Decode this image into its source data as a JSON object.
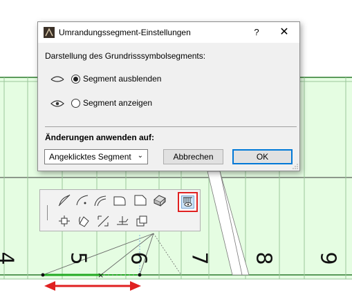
{
  "dialog": {
    "title": "Umrandungssegment-Einstellungen",
    "help_glyph": "?",
    "close_glyph": "✕",
    "group_label": "Darstellung des Grundrisssymbolsegments:",
    "options": [
      {
        "label": "Segment ausblenden",
        "selected": true,
        "icon": "eye-closed-icon"
      },
      {
        "label": "Segment anzeigen",
        "selected": false,
        "icon": "eye-open-icon"
      }
    ],
    "apply_label": "Änderungen anwenden auf:",
    "apply_select_value": "Angeklicktes Segment",
    "cancel_label": "Abbrechen",
    "ok_label": "OK"
  },
  "drawing": {
    "grid_labels": [
      "4",
      "5",
      "6",
      "7",
      "8",
      "9"
    ],
    "background_color": "#e5fde2",
    "line_color": "#2a7a2a",
    "highlight_color": "#e02020"
  },
  "palette": {
    "tools": [
      "arc-tangent-icon",
      "arc-center-icon",
      "arc-three-point-icon",
      "corner-round-icon",
      "corner-chamfer-icon",
      "extrude-3d-icon",
      "segment-visibility-icon",
      "move-node-icon",
      "rotate-node-icon",
      "offset-segment-icon",
      "mirror-icon",
      "copy-icon"
    ],
    "active_tool": "segment-visibility-icon"
  }
}
